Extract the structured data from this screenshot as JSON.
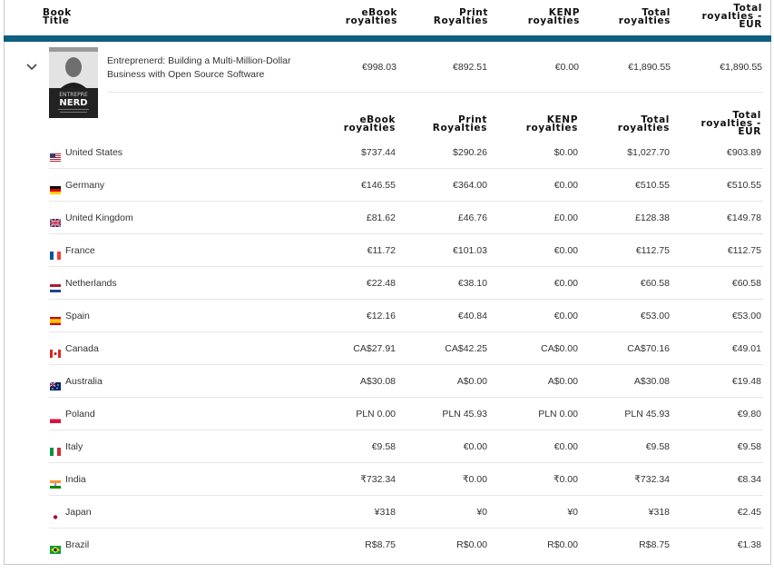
{
  "header": {
    "book_title": [
      "Book",
      "Title"
    ],
    "ebook": [
      "eBook",
      "royalties"
    ],
    "print": [
      "Print",
      "Royalties"
    ],
    "kenp": [
      "KENP",
      "royalties"
    ],
    "total": [
      "Total",
      "royalties"
    ],
    "total_eur": [
      "Total",
      "royalties -",
      "EUR"
    ]
  },
  "book": {
    "title_line1": "Entreprenerd: Building a Multi-Million-Dollar",
    "title_line2": "Business with Open Source Software",
    "cover_text_top": "ENTREPRE",
    "cover_text_bottom": "NERD",
    "ebook": "€998.03",
    "print": "€892.51",
    "kenp": "€0.00",
    "total": "€1,890.55",
    "total_eur": "€1,890.55"
  },
  "subheader": {
    "ebook": [
      "eBook",
      "royalties"
    ],
    "print": [
      "Print",
      "Royalties"
    ],
    "kenp": [
      "KENP",
      "royalties"
    ],
    "total": [
      "Total",
      "royalties"
    ],
    "total_eur": [
      "Total",
      "royalties -",
      "EUR"
    ]
  },
  "rows": [
    {
      "country": "United States",
      "flag": "us",
      "ebook": "$737.44",
      "print": "$290.26",
      "kenp": "$0.00",
      "total": "$1,027.70",
      "eur": "€903.89"
    },
    {
      "country": "Germany",
      "flag": "de",
      "ebook": "€146.55",
      "print": "€364.00",
      "kenp": "€0.00",
      "total": "€510.55",
      "eur": "€510.55"
    },
    {
      "country": "United Kingdom",
      "flag": "gb",
      "ebook": "£81.62",
      "print": "£46.76",
      "kenp": "£0.00",
      "total": "£128.38",
      "eur": "€149.78"
    },
    {
      "country": "France",
      "flag": "fr",
      "ebook": "€11.72",
      "print": "€101.03",
      "kenp": "€0.00",
      "total": "€112.75",
      "eur": "€112.75"
    },
    {
      "country": "Netherlands",
      "flag": "nl",
      "ebook": "€22.48",
      "print": "€38.10",
      "kenp": "€0.00",
      "total": "€60.58",
      "eur": "€60.58"
    },
    {
      "country": "Spain",
      "flag": "es",
      "ebook": "€12.16",
      "print": "€40.84",
      "kenp": "€0.00",
      "total": "€53.00",
      "eur": "€53.00"
    },
    {
      "country": "Canada",
      "flag": "ca",
      "ebook": "CA$27.91",
      "print": "CA$42.25",
      "kenp": "CA$0.00",
      "total": "CA$70.16",
      "eur": "€49.01"
    },
    {
      "country": "Australia",
      "flag": "au",
      "ebook": "A$30.08",
      "print": "A$0.00",
      "kenp": "A$0.00",
      "total": "A$30.08",
      "eur": "€19.48"
    },
    {
      "country": "Poland",
      "flag": "pl",
      "ebook": "PLN 0.00",
      "print": "PLN 45.93",
      "kenp": "PLN 0.00",
      "total": "PLN 45.93",
      "eur": "€9.80"
    },
    {
      "country": "Italy",
      "flag": "it",
      "ebook": "€9.58",
      "print": "€0.00",
      "kenp": "€0.00",
      "total": "€9.58",
      "eur": "€9.58"
    },
    {
      "country": "India",
      "flag": "in",
      "ebook": "₹732.34",
      "print": "₹0.00",
      "kenp": "₹0.00",
      "total": "₹732.34",
      "eur": "€8.34"
    },
    {
      "country": "Japan",
      "flag": "jp",
      "ebook": "¥318",
      "print": "¥0",
      "kenp": "¥0",
      "total": "¥318",
      "eur": "€2.45"
    },
    {
      "country": "Brazil",
      "flag": "br",
      "ebook": "R$8.75",
      "print": "R$0.00",
      "kenp": "R$0.00",
      "total": "R$8.75",
      "eur": "€1.38"
    }
  ],
  "colors": {
    "header_bar": "#0f5f7e",
    "row_separator": "#e6e6e6"
  }
}
